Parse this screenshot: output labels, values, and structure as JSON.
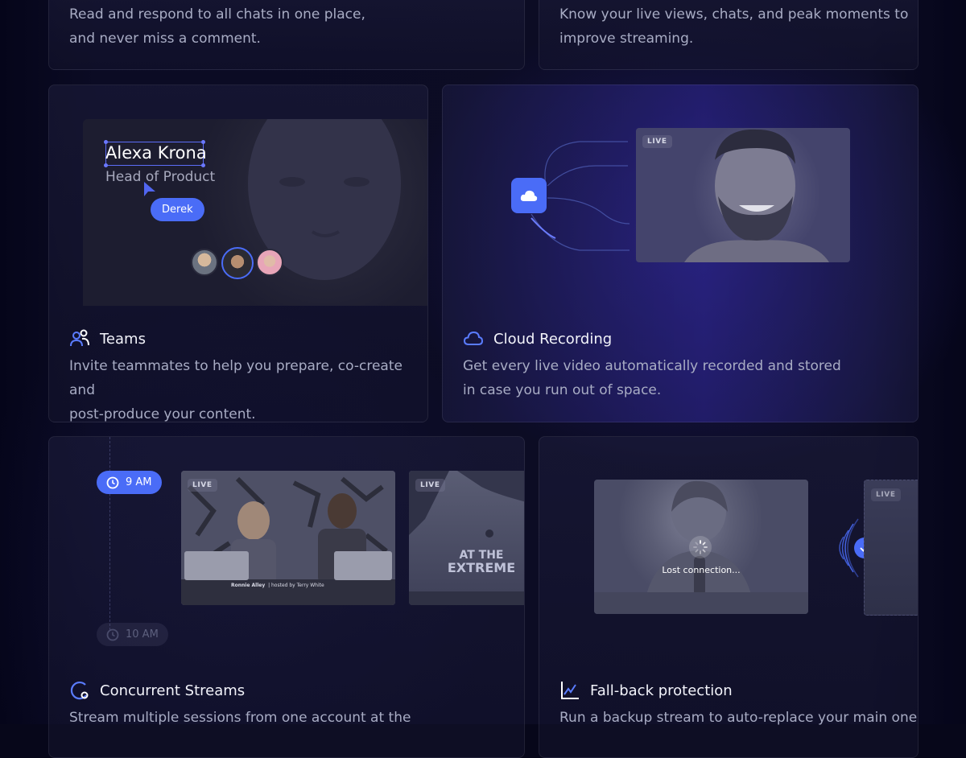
{
  "top_left_card": {
    "desc_lines": [
      "Read and respond to all chats in one place,",
      "and never miss a comment."
    ]
  },
  "top_right_card": {
    "desc_lines": [
      "Know your live views, chats, and peak moments to",
      "improve streaming."
    ]
  },
  "teams_card": {
    "title": "Teams",
    "title_icon": "users-icon",
    "desc_lines": [
      "Invite teammates to help you prepare, co-create and",
      "post-produce your content."
    ],
    "preview": {
      "name": "Alexa Krona",
      "role": "Head of Product",
      "cursor_label": "Derek",
      "avatars": [
        "avatar-man-blond",
        "avatar-man-dark-hair",
        "avatar-woman"
      ]
    }
  },
  "cloud_card": {
    "title": "Cloud Recording",
    "title_icon": "cloud-icon",
    "desc_lines": [
      "Get every live video automatically recorded and stored",
      "in case you run out of space."
    ],
    "preview": {
      "live_label": "LIVE"
    }
  },
  "concurrent_card": {
    "title": "Concurrent Streams",
    "title_icon": "concurrent-icon",
    "desc_lines": [
      "Stream multiple sessions from one account at the"
    ],
    "preview": {
      "time_active": "9 AM",
      "time_inactive": "10 AM",
      "live_label_1": "LIVE",
      "live_label_2": "LIVE",
      "caption_name": "Ronnie Alley",
      "caption_host": "hosted by Terry White",
      "poster_text_1": "AT THE",
      "poster_text_2": "EXTREME"
    }
  },
  "fallback_card": {
    "title": "Fall-back protection",
    "title_icon": "chart-icon",
    "desc_lines": [
      "Run a backup stream to auto-replace your main one"
    ],
    "preview": {
      "status": "Lost connection...",
      "live_label": "LIVE"
    }
  },
  "colors": {
    "accent": "#4a6cf7",
    "background": "#07071a",
    "card_text": "#a8acc4"
  }
}
